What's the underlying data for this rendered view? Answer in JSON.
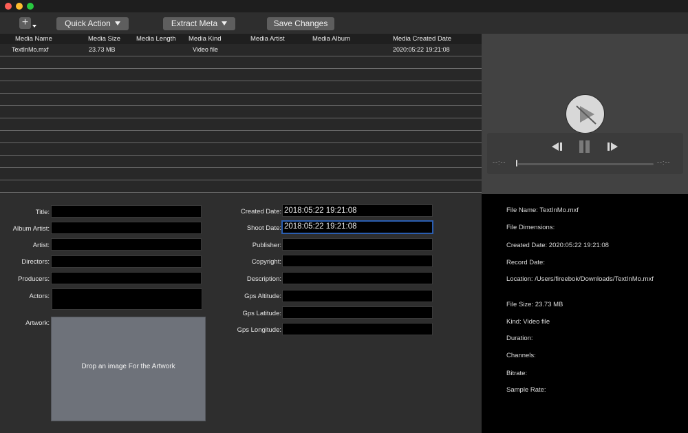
{
  "toolbar": {
    "add_label": "+",
    "quick_action": "Quick Action",
    "extract_meta": "Extract Meta",
    "save_changes": "Save Changes"
  },
  "table": {
    "columns": [
      "Media Name",
      "Media Size",
      "Media Length",
      "Media Kind",
      "Media Artist",
      "Media Album",
      "Media Created Date"
    ],
    "rows": [
      {
        "name": "TextInMo.mxf",
        "size": "23.73 MB",
        "length": "",
        "kind": "Video file",
        "artist": "",
        "album": "",
        "created": "2020:05:22 19:21:08"
      }
    ]
  },
  "player": {
    "time_start": "--:--",
    "time_end": "--:--",
    "progress": 0
  },
  "form_left": {
    "title": {
      "label": "Title:",
      "value": ""
    },
    "album_artist": {
      "label": "Album Artist:",
      "value": ""
    },
    "artist": {
      "label": "Artist:",
      "value": ""
    },
    "directors": {
      "label": "Directors:",
      "value": ""
    },
    "producers": {
      "label": "Producers:",
      "value": ""
    },
    "actors": {
      "label": "Actors:",
      "value": ""
    },
    "artwork": {
      "label": "Artwork:",
      "placeholder": "Drop an image For the Artwork"
    }
  },
  "form_right": {
    "created_date": {
      "label": "Created Date:",
      "value": "2018:05:22 19:21:08"
    },
    "shoot_date": {
      "label": "Shoot Date:",
      "value": "2018:05:22 19:21:08"
    },
    "publisher": {
      "label": "Publisher:",
      "value": ""
    },
    "copyright": {
      "label": "Copyright:",
      "value": ""
    },
    "description": {
      "label": "Description:",
      "value": ""
    },
    "gps_altitude": {
      "label": "Gps Altitude:",
      "value": ""
    },
    "gps_latitude": {
      "label": "Gps Latitude:",
      "value": ""
    },
    "gps_longitude": {
      "label": "Gps Longitude:",
      "value": ""
    }
  },
  "info": {
    "file_name": "File Name: TextInMo.mxf",
    "file_dimensions": "File Dimensions:",
    "created_date": "Created Date: 2020:05:22 19:21:08",
    "record_date": "Record Date:",
    "location": "Location: /Users/fireebok/Downloads/TextInMo.mxf",
    "file_size": "File Size: 23.73 MB",
    "kind": "Kind: Video file",
    "duration": "Duration:",
    "channels": "Channels:",
    "bitrate": "Bitrate:",
    "sample_rate": "Sample Rate:"
  },
  "colors": {
    "focus_border": "#2a5db0",
    "artwork_bg": "#6e727a"
  }
}
